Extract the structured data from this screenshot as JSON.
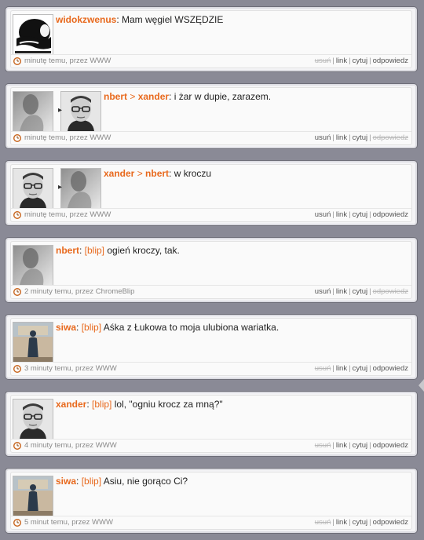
{
  "posts": [
    {
      "author": "widokzwenus",
      "target": "",
      "tag": "",
      "text": "Mam węgiel WSZĘDZIE",
      "meta": "minutę temu, przez WWW",
      "actions": [
        {
          "label": "usuń",
          "disabled": true
        },
        {
          "label": "link",
          "disabled": false
        },
        {
          "label": "cytuj",
          "disabled": false
        },
        {
          "label": "odpowiedz",
          "disabled": false
        }
      ],
      "avatars": [
        "mustache-avatar"
      ]
    },
    {
      "author": "nbert",
      "target": "xander",
      "tag": "",
      "text": "i żar w dupie, zarazem.",
      "meta": "minutę temu, przez WWW",
      "actions": [
        {
          "label": "usuń",
          "disabled": false
        },
        {
          "label": "link",
          "disabled": false
        },
        {
          "label": "cytuj",
          "disabled": false
        },
        {
          "label": "odpowiedz",
          "disabled": true
        }
      ],
      "avatars": [
        "shadow-avatar",
        "glasses-avatar"
      ]
    },
    {
      "author": "xander",
      "target": "nbert",
      "tag": "",
      "text": "w kroczu",
      "meta": "minutę temu, przez WWW",
      "actions": [
        {
          "label": "usuń",
          "disabled": false
        },
        {
          "label": "link",
          "disabled": false
        },
        {
          "label": "cytuj",
          "disabled": false
        },
        {
          "label": "odpowiedz",
          "disabled": false
        }
      ],
      "avatars": [
        "glasses-avatar",
        "shadow-avatar"
      ]
    },
    {
      "author": "nbert",
      "target": "",
      "tag": "[blip]",
      "text": "ogień kroczy, tak.",
      "meta": "2 minuty temu, przez ChromeBlip",
      "actions": [
        {
          "label": "usuń",
          "disabled": false
        },
        {
          "label": "link",
          "disabled": false
        },
        {
          "label": "cytuj",
          "disabled": false
        },
        {
          "label": "odpowiedz",
          "disabled": true
        }
      ],
      "avatars": [
        "shadow-avatar"
      ]
    },
    {
      "author": "siwa",
      "target": "",
      "tag": "[blip]",
      "text": "Aśka z Łukowa to moja ulubiona wariatka.",
      "meta": "3 minuty temu, przez WWW",
      "actions": [
        {
          "label": "usuń",
          "disabled": true
        },
        {
          "label": "link",
          "disabled": false
        },
        {
          "label": "cytuj",
          "disabled": false
        },
        {
          "label": "odpowiedz",
          "disabled": false
        }
      ],
      "avatars": [
        "figure-avatar"
      ]
    },
    {
      "author": "xander",
      "target": "",
      "tag": "[blip]",
      "text": "lol, \"ogniu krocz za mną?\"",
      "meta": "4 minuty temu, przez WWW",
      "actions": [
        {
          "label": "usuń",
          "disabled": true
        },
        {
          "label": "link",
          "disabled": false
        },
        {
          "label": "cytuj",
          "disabled": false
        },
        {
          "label": "odpowiedz",
          "disabled": false
        }
      ],
      "avatars": [
        "glasses-avatar"
      ]
    },
    {
      "author": "siwa",
      "target": "",
      "tag": "[blip]",
      "text": "Asiu, nie gorąco Ci?",
      "meta": "5 minut temu, przez WWW",
      "actions": [
        {
          "label": "usuń",
          "disabled": true
        },
        {
          "label": "link",
          "disabled": false
        },
        {
          "label": "cytuj",
          "disabled": false
        },
        {
          "label": "odpowiedz",
          "disabled": false
        }
      ],
      "avatars": [
        "figure-avatar"
      ]
    }
  ],
  "colors": {
    "accent": "#e8691d",
    "background": "#8a8a96"
  }
}
